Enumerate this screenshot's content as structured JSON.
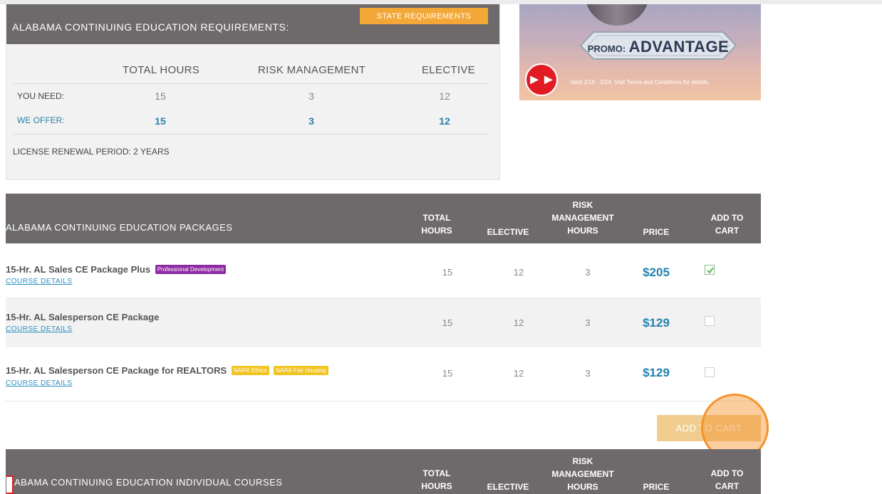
{
  "requirements": {
    "title": "ALABAMA CONTINUING EDUCATION REQUIREMENTS:",
    "state_button": "STATE REQUIREMENTS",
    "columns": [
      "TOTAL HOURS",
      "RISK MANAGEMENT",
      "ELECTIVE"
    ],
    "you_need": {
      "label": "YOU NEED:",
      "total": "15",
      "risk": "3",
      "elective": "12"
    },
    "we_offer": {
      "label": "WE OFFER:",
      "total": "15",
      "risk": "3",
      "elective": "12"
    },
    "renewal": "LICENSE RENEWAL PERIOD: 2 YEARS"
  },
  "promo": {
    "label": "PROMO:",
    "code": "ADVANTAGE",
    "valid": "Valid 2/19 - 2/24. Visit Terms and Conditions for details."
  },
  "packages": {
    "title": "ALABAMA CONTINUING EDUCATION PACKAGES",
    "headers": {
      "total": [
        "TOTAL",
        "HOURS"
      ],
      "elective": "ELECTIVE",
      "risk": [
        "RISK",
        "MANAGEMENT",
        "HOURS"
      ],
      "price": "PRICE",
      "cart": [
        "ADD TO",
        "CART"
      ]
    },
    "rows": [
      {
        "name": "15-Hr. AL Sales CE Package Plus",
        "badges": [
          "Professional Development"
        ],
        "link": "COURSE DETAILS",
        "total": "15",
        "elective": "12",
        "risk": "3",
        "price": "$205",
        "checked": true
      },
      {
        "name": "15-Hr. AL Salesperson CE Package",
        "badges": [],
        "link": "COURSE DETAILS",
        "total": "15",
        "elective": "12",
        "risk": "3",
        "price": "$129",
        "checked": false
      },
      {
        "name": "15-Hr. AL Salesperson CE Package for REALTORS",
        "badges": [
          "NAR® Ethics",
          "NAR® Fair Housing"
        ],
        "link": "COURSE DETAILS",
        "total": "15",
        "elective": "12",
        "risk": "3",
        "price": "$129",
        "checked": false
      }
    ],
    "add_to_cart": "ADD TO CART"
  },
  "individual": {
    "title": "ABAMA CONTINUING EDUCATION INDIVIDUAL COURSES",
    "headers": {
      "total": [
        "TOTAL",
        "HOURS"
      ],
      "elective": "ELECTIVE",
      "risk": [
        "RISK",
        "MANAGEMENT",
        "HOURS"
      ],
      "price": "PRICE",
      "cart": [
        "ADD TO",
        "CART"
      ]
    }
  },
  "colors": {
    "header_bg": "#6e6a6b",
    "accent_orange": "#f2a737",
    "link_blue": "#2a8fbf",
    "price_blue": "#2382b0"
  }
}
